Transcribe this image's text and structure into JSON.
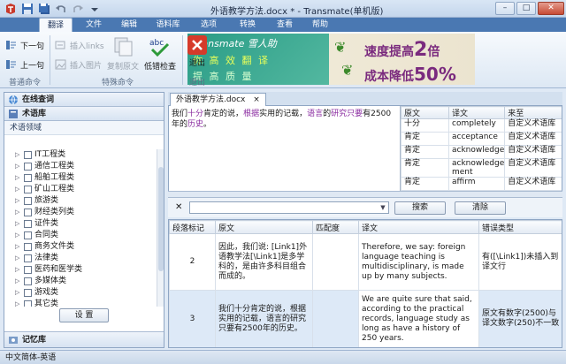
{
  "window": {
    "title": "外语教学方法.docx * - Transmate(单机版)",
    "controls": {
      "minimize": "–",
      "maximize": "□",
      "close": "✕"
    }
  },
  "ribbon_tabs": [
    "翻译",
    "文件",
    "编辑",
    "语料库",
    "选项",
    "转换",
    "查看",
    "帮助"
  ],
  "ribbon": {
    "next_sentence": "下一句",
    "prev_sentence": "上一句",
    "insert_link": "插入links",
    "insert_image": "插入图片",
    "copy_source": "复制原文",
    "low_err_check": "低错检查",
    "exit": "退出",
    "group_normal": "普通命令",
    "group_special": "特殊命令",
    "group_exit": "退出"
  },
  "banner": {
    "left_line1": "Transmate 雪人助",
    "left_line2": "你 高 效 翻 译",
    "left_line3": "提 高 质 量",
    "right_line1_prefix": "速度提高",
    "right_line1_num": "2",
    "right_line1_suffix": "倍",
    "right_line2_prefix": "成本降低",
    "right_line2_num": "50%"
  },
  "left_panel": {
    "online_query": "在线查词",
    "term_library": "术语库",
    "term_domain": "术语领域",
    "tree_items": [
      {
        "label": "IT工程类",
        "checked": false,
        "child": false
      },
      {
        "label": "通信工程类",
        "checked": false,
        "child": false
      },
      {
        "label": "船舶工程类",
        "checked": false,
        "child": false
      },
      {
        "label": "矿山工程类",
        "checked": false,
        "child": false
      },
      {
        "label": "旅游类",
        "checked": false,
        "child": false
      },
      {
        "label": "财经类列类",
        "checked": false,
        "child": false
      },
      {
        "label": "证件类",
        "checked": false,
        "child": false
      },
      {
        "label": "合同类",
        "checked": false,
        "child": false
      },
      {
        "label": "商务文件类",
        "checked": false,
        "child": false
      },
      {
        "label": "法律类",
        "checked": false,
        "child": false
      },
      {
        "label": "医药和医学类",
        "checked": false,
        "child": false
      },
      {
        "label": "多媒体类",
        "checked": false,
        "child": false
      },
      {
        "label": "游戏类",
        "checked": false,
        "child": false
      },
      {
        "label": "其它类",
        "checked": false,
        "child": false
      },
      {
        "label": "其它",
        "checked": true,
        "child": true
      }
    ],
    "settings_button": "设 置",
    "memory_library": "记忆库"
  },
  "document": {
    "tab_label": "外语教学方法.docx",
    "tab_close": "×",
    "source_parts": [
      {
        "text": "我们",
        "hl": false
      },
      {
        "text": "十分",
        "hl": true
      },
      {
        "text": "肯定",
        "hl": false
      },
      {
        "text": "的说，",
        "hl": false
      },
      {
        "text": "根据",
        "hl": true
      },
      {
        "text": "实用的记载，",
        "hl": false
      },
      {
        "text": "语言",
        "hl": true
      },
      {
        "text": "的",
        "hl": false
      },
      {
        "text": "研究",
        "hl": true
      },
      {
        "text": "只要",
        "hl": true
      },
      {
        "text": "有2500年的",
        "hl": false
      },
      {
        "text": "历史",
        "hl": true
      },
      {
        "text": "。",
        "hl": false
      }
    ]
  },
  "term_table": {
    "headers": [
      "原文",
      "译文",
      "来至"
    ],
    "rows": [
      [
        "十分",
        "completely",
        "自定义术语库"
      ],
      [
        "肯定",
        "acceptance",
        "自定义术语库"
      ],
      [
        "肯定",
        "acknowledge",
        "自定义术语库"
      ],
      [
        "肯定",
        "acknowledge ment",
        "自定义术语库"
      ],
      [
        "肯定",
        "affirm",
        "自定义术语库"
      ]
    ]
  },
  "search": {
    "clear_icon": "✕",
    "search_button": "搜索",
    "clear_button": "清除"
  },
  "grid": {
    "headers": [
      "段落标记",
      "原文",
      "匹配度",
      "译文",
      "错误类型"
    ],
    "rows": [
      {
        "num": "2",
        "source": "因此，我们说: [Link1]外语教学法[\\Link1]是多学科的，是由许多科目组合而成的。",
        "match": "",
        "target": "Therefore, we say: foreign language teaching is multidisciplinary, is made up by many subjects.",
        "error": "有([\\Link1])未插入到译文行"
      },
      {
        "num": "3",
        "source": "我们十分肯定的说，根据实用的记载，语言的研究只要有2500年的历史。",
        "match": "",
        "target": "We are quite sure that said, according to the practical records, language study as long as have a history of 250 years.",
        "error": "原文有数字(2500)与译文数字(250)不一致"
      }
    ]
  },
  "status": {
    "lang_pair": "中文简体-英语"
  },
  "colors": {
    "tab_bar": "#4a78b2",
    "highlight_term": "#8a2ba0",
    "selected_row": "#dde9f7",
    "banner_green": "#2a9c86",
    "banner_purple": "#7a2a7e"
  }
}
